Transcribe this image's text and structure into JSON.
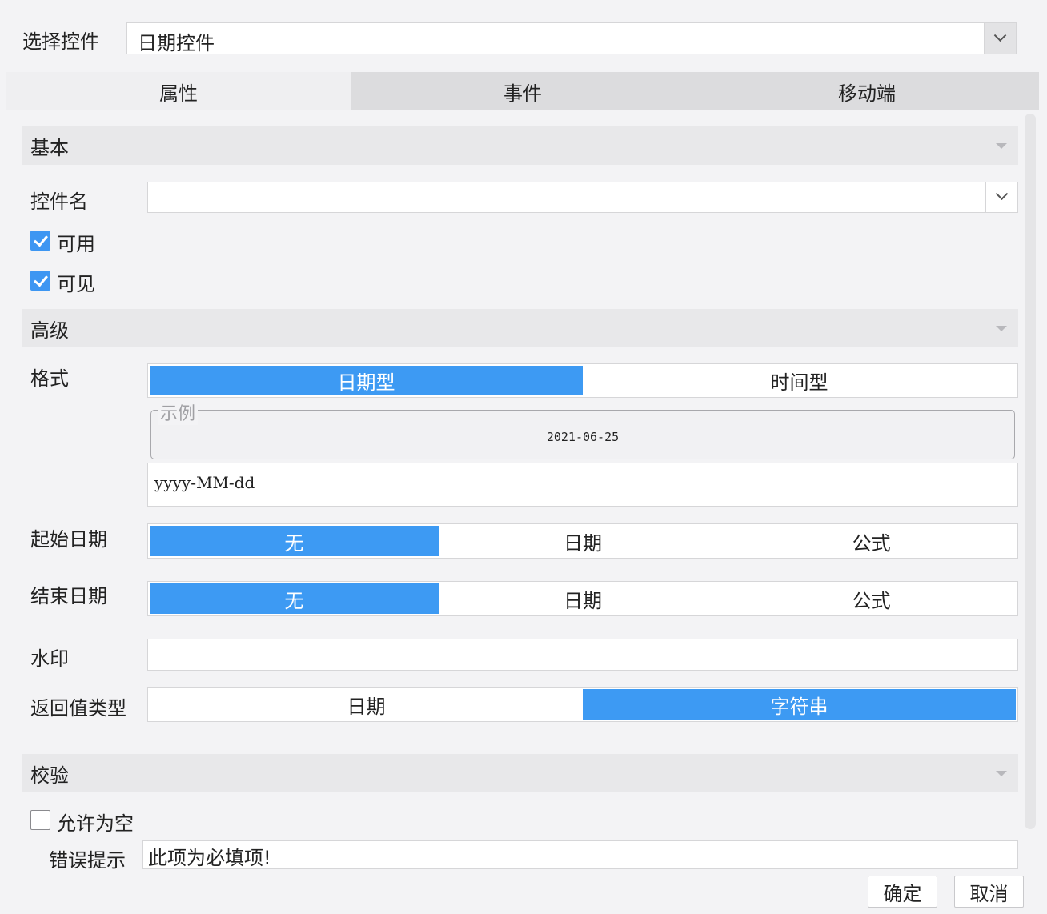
{
  "control_select": {
    "label": "选择控件",
    "value": "日期控件"
  },
  "tabs": [
    {
      "label": "属性",
      "active": true
    },
    {
      "label": "事件",
      "active": false
    },
    {
      "label": "移动端",
      "active": false
    }
  ],
  "basic": {
    "title": "基本",
    "control_name_label": "控件名",
    "control_name_value": "",
    "enabled_label": "可用",
    "enabled": true,
    "visible_label": "可见",
    "visible": true
  },
  "advanced": {
    "title": "高级",
    "format_label": "格式",
    "format_options": [
      "日期型",
      "时间型"
    ],
    "format_selected": "日期型",
    "example_legend": "示例",
    "example_value": "2021-06-25",
    "format_pattern": "yyyy-MM-dd",
    "start_date_label": "起始日期",
    "start_date_options": [
      "无",
      "日期",
      "公式"
    ],
    "start_date_selected": "无",
    "end_date_label": "结束日期",
    "end_date_options": [
      "无",
      "日期",
      "公式"
    ],
    "end_date_selected": "无",
    "watermark_label": "水印",
    "watermark_value": "",
    "return_type_label": "返回值类型",
    "return_type_options": [
      "日期",
      "字符串"
    ],
    "return_type_selected": "字符串"
  },
  "validation": {
    "title": "校验",
    "allow_empty_label": "允许为空",
    "allow_empty": false,
    "error_label": "错误提示",
    "error_value": "此项为必填项!"
  },
  "footer": {
    "ok_label": "确定",
    "cancel_label": "取消"
  },
  "colors": {
    "accent": "#3d9af3",
    "checkbox": "#3d96f2",
    "background": "#f3f3f5"
  }
}
